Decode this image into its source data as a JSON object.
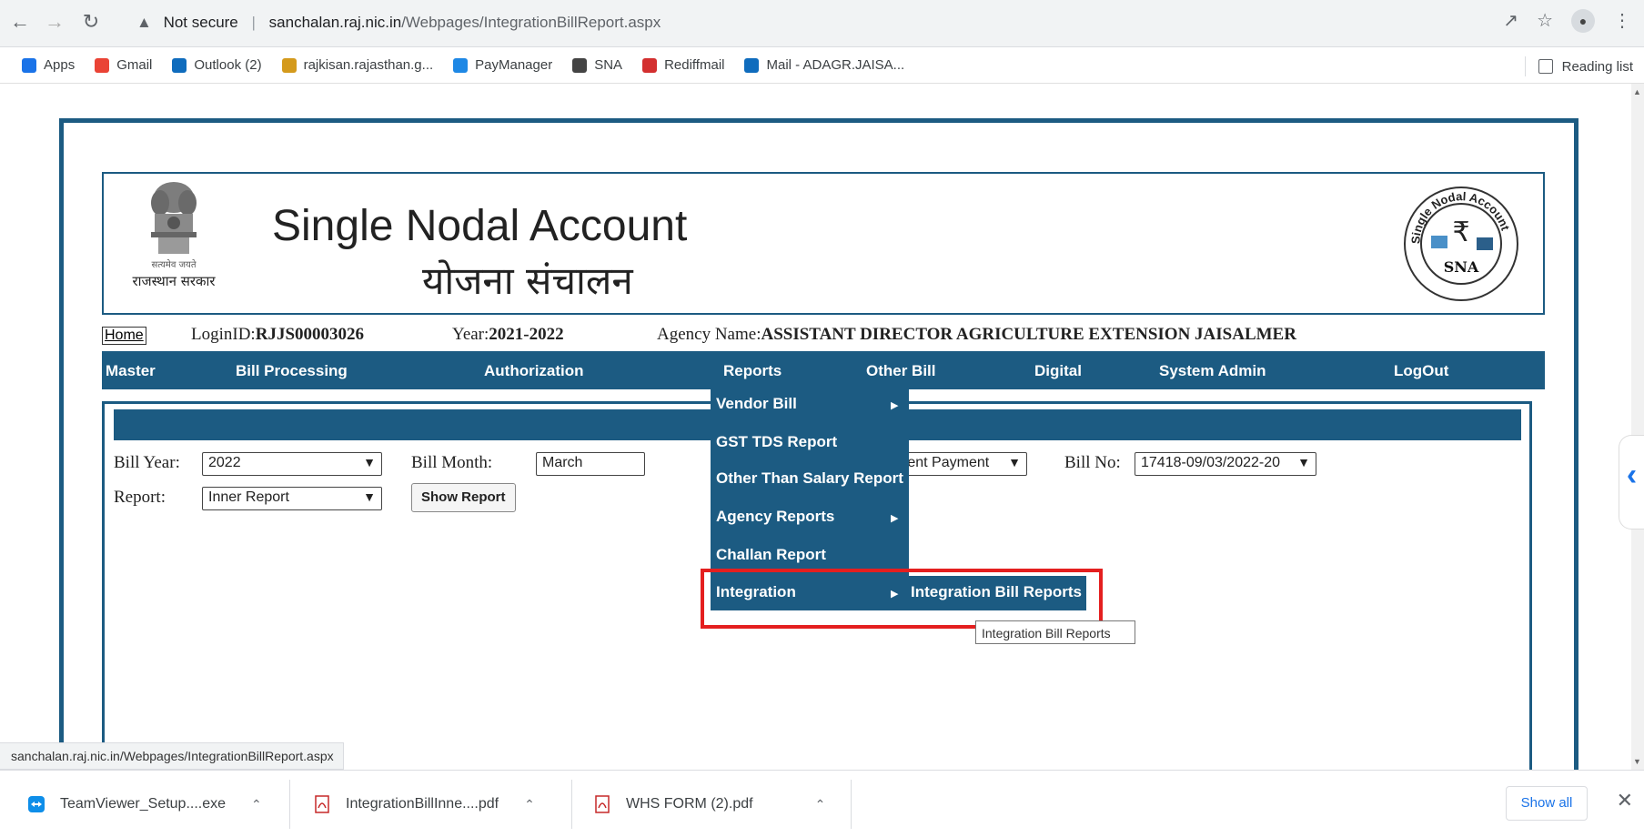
{
  "browser": {
    "security_label": "Not secure",
    "url_host": "sanchalan.raj.nic.in",
    "url_path": "/Webpages/IntegrationBillReport.aspx",
    "reading_list": "Reading list",
    "avatar_initial": "●"
  },
  "bookmarks": [
    {
      "label": "Apps",
      "icon": "apps-grid-icon",
      "color": "#1a73e8"
    },
    {
      "label": "Gmail",
      "icon": "gmail-icon",
      "color": "#ea4335"
    },
    {
      "label": "Outlook (2)",
      "icon": "outlook-icon",
      "color": "#0f6cbd"
    },
    {
      "label": "rajkisan.rajasthan.g...",
      "icon": "rajkisan-icon",
      "color": "#d49a1c"
    },
    {
      "label": "PayManager",
      "icon": "paymanager-icon",
      "color": "#1e88e5"
    },
    {
      "label": "SNA",
      "icon": "sna-globe-icon",
      "color": "#444444"
    },
    {
      "label": "Rediffmail",
      "icon": "rediffmail-icon",
      "color": "#d32f2f"
    },
    {
      "label": "Mail - ADAGR.JAISA...",
      "icon": "outlook-icon",
      "color": "#0f6cbd"
    }
  ],
  "header": {
    "title_en": "Single Nodal Account",
    "title_hi": "योजना संचालन",
    "emblem_motto": "सत्यमेव जयते",
    "emblem_gov": "राजस्थान सरकार",
    "logo_text": "SNA",
    "logo_ring": "Single Nodal Account",
    "logo_symbol": "₹"
  },
  "info": {
    "home": "Home",
    "login_label": "LoginID:",
    "login_value": "RJJS00003026",
    "year_label": "Year:",
    "year_value": "2021-2022",
    "agency_label": "Agency Name:",
    "agency_value": "ASSISTANT DIRECTOR AGRICULTURE EXTENSION JAISALMER"
  },
  "menu": [
    "Master",
    "Bill Processing",
    "Authorization",
    "Reports",
    "Other Bill",
    "Digital",
    "System Admin",
    "LogOut"
  ],
  "form": {
    "bill_year_label": "Bill Year:",
    "bill_year_value": "2022",
    "bill_month_label": "Bill Month:",
    "bill_month_value": "March",
    "type_label_partial": "e:",
    "type_value": "Department Payment",
    "bill_no_label": "Bill No:",
    "bill_no_value": "17418-09/03/2022-20",
    "report_label": "Report:",
    "report_value": "Inner Report",
    "show_report": "Show Report"
  },
  "reports_dropdown": [
    {
      "label": "Vendor Bill",
      "has_sub": true
    },
    {
      "label": "GST TDS Report",
      "has_sub": false
    },
    {
      "label": "Other Than Salary Report",
      "has_sub": false
    },
    {
      "label": "Agency Reports",
      "has_sub": true
    },
    {
      "label": "Challan Report",
      "has_sub": false
    },
    {
      "label": "Integration",
      "has_sub": true
    }
  ],
  "submenu_item": "Integration Bill Reports",
  "tooltip": "Integration Bill Reports",
  "status_url": "sanchalan.raj.nic.in/Webpages/IntegrationBillReport.aspx",
  "downloads": [
    {
      "name": "TeamViewer_Setup....exe",
      "icon": "teamviewer-icon"
    },
    {
      "name": "IntegrationBillInne....pdf",
      "icon": "pdf-icon"
    },
    {
      "name": "WHS FORM (2).pdf",
      "icon": "pdf-icon"
    }
  ],
  "show_all": "Show all",
  "colors": {
    "brand": "#1c5b82",
    "highlight": "#e41f1f"
  }
}
